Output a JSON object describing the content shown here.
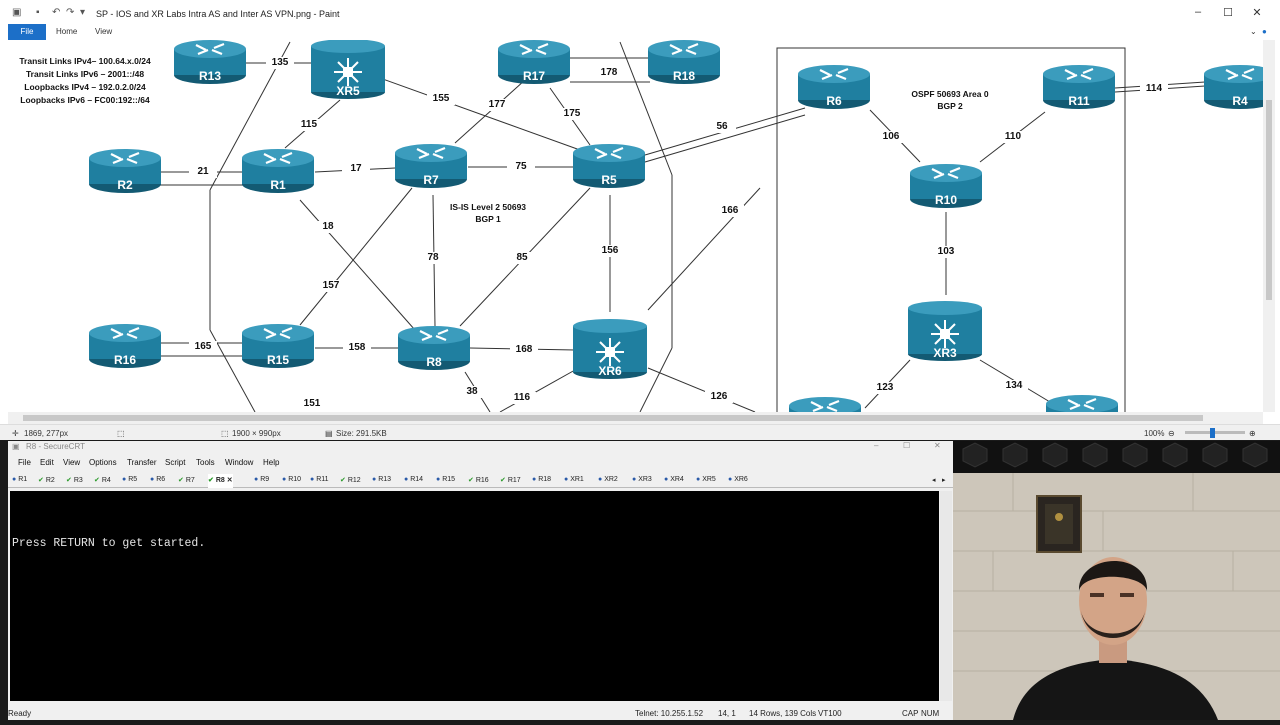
{
  "paint": {
    "title": "SP - IOS and XR Labs Intra AS and Inter AS VPN.png - Paint",
    "ribbon": {
      "file": "File",
      "tabs": [
        "Home",
        "View"
      ]
    },
    "status": {
      "cursor": "1869, 277px",
      "dimensions": "1900 × 990px",
      "size": "Size: 291.5KB",
      "zoom": "100%"
    }
  },
  "diagram": {
    "legend": [
      "Transit Links IPv4– 100.64.x.0/24",
      "Transit Links IPv6 – 2001::/48",
      "Loopbacks IPv4 – 192.0.2.0/24",
      "Loopbacks IPv6 – FC00:192::/64"
    ],
    "isis_label": [
      "IS-IS Level 2 50693",
      "BGP 1"
    ],
    "ospf_label": [
      "OSPF 50693 Area 0",
      "BGP 2"
    ],
    "routers": {
      "R13": "R13",
      "XR5": "XR5",
      "R17": "R17",
      "R18": "R18",
      "R6": "R6",
      "R11": "R11",
      "R4": "R4",
      "R2": "R2",
      "R1": "R1",
      "R7": "R7",
      "R5": "R5",
      "R10": "R10",
      "R16": "R16",
      "R15": "R15",
      "R8": "R8",
      "XR6": "XR6",
      "XR3": "XR3"
    },
    "links": {
      "l135": "135",
      "l178": "178",
      "l114": "114",
      "l155": "155",
      "l177": "177",
      "l175": "175",
      "l115": "115",
      "l56": "56",
      "l106": "106",
      "l110": "110",
      "l21": "21",
      "l17": "17",
      "l75": "75",
      "l18": "18",
      "l166": "166",
      "l103": "103",
      "l156": "156",
      "l78": "78",
      "l85": "85",
      "l157": "157",
      "l165": "165",
      "l158": "158",
      "l168": "168",
      "l151": "151",
      "l38": "38",
      "l116": "116",
      "l126": "126",
      "l123": "123",
      "l134": "134"
    }
  },
  "securecrt": {
    "title": "R8 - SecureCRT",
    "menu": [
      "File",
      "Edit",
      "View",
      "Options",
      "Transfer",
      "Script",
      "Tools",
      "Window",
      "Help"
    ],
    "tabs": [
      "R1",
      "R2",
      "R3",
      "R4",
      "R5",
      "R6",
      "R7",
      "R8",
      "R9",
      "R10",
      "R11",
      "R12",
      "R13",
      "R14",
      "R15",
      "R16",
      "R17",
      "R18",
      "XR1",
      "XR2",
      "XR3",
      "XR4",
      "XR5",
      "XR6"
    ],
    "active_tab": "R8",
    "terminal_line": "Press RETURN to get started.",
    "status": {
      "ready": "Ready",
      "telnet": "Telnet: 10.255.1.52",
      "pos": "14,  1",
      "size": "14 Rows, 139 Cols",
      "term": "VT100",
      "cap": "CAP",
      "num": "NUM"
    }
  },
  "colors": {
    "router": "#1f7fa0",
    "router_dark": "#135a73",
    "file_tab": "#1c6fc8"
  }
}
